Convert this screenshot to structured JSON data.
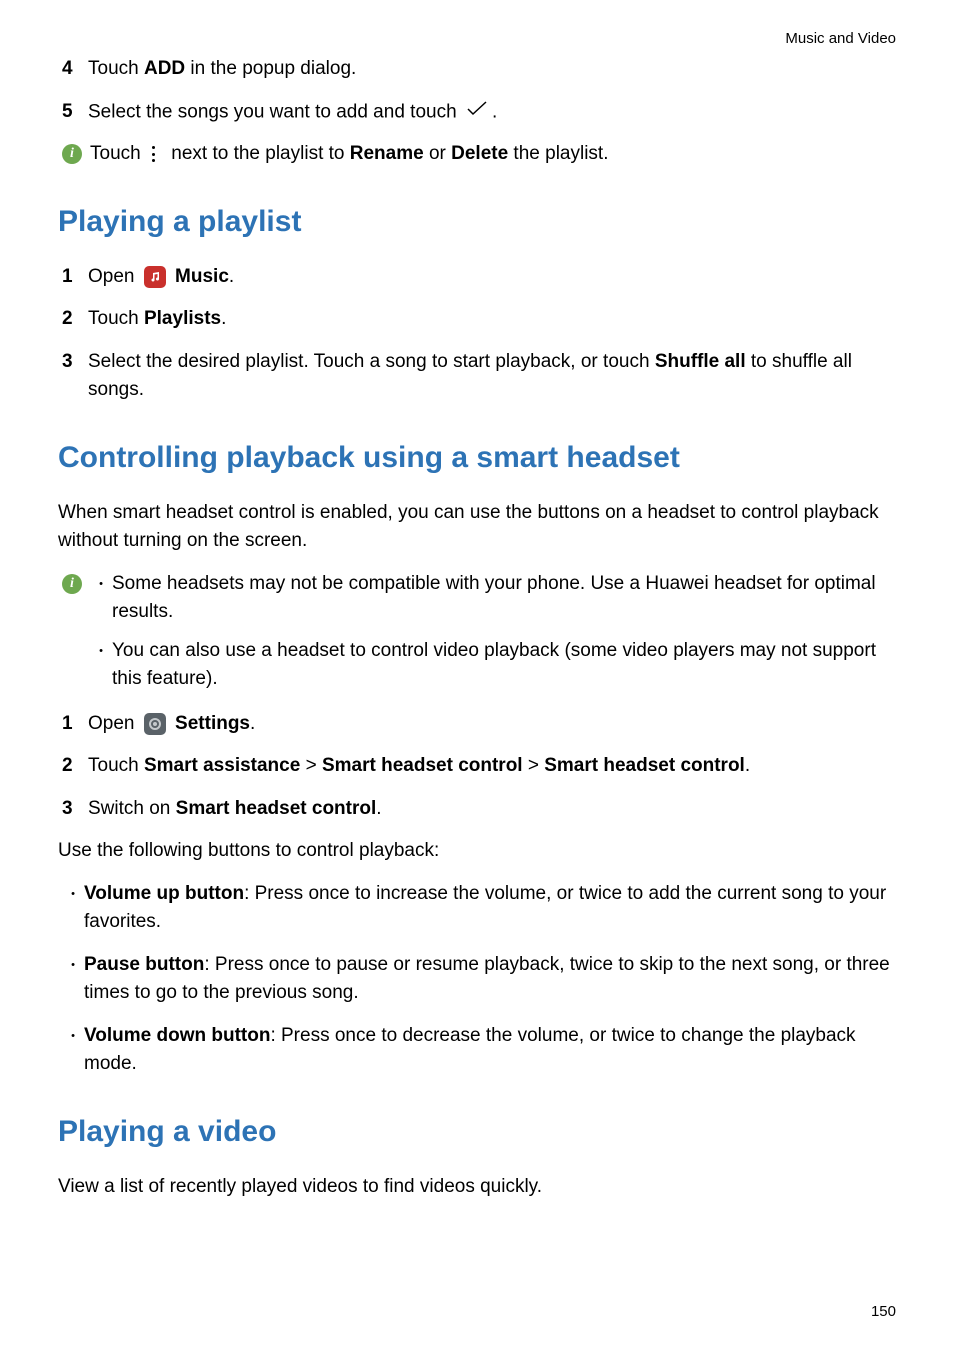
{
  "header": "Music and Video",
  "step4": {
    "num": "4",
    "pre": "Touch ",
    "bold": "ADD",
    "post": " in the popup dialog."
  },
  "step5": {
    "num": "5",
    "pre": "Select the songs you want to add and touch ",
    "post": "."
  },
  "tip1": {
    "pre": "Touch ",
    "mid": " next to the playlist to ",
    "b1": "Rename",
    "or": " or ",
    "b2": "Delete",
    "post": " the playlist."
  },
  "heading1": "Playing a playlist",
  "p1": {
    "num": "1",
    "pre": "Open ",
    "bold": "Music",
    "post": "."
  },
  "p2": {
    "num": "2",
    "pre": "Touch ",
    "bold": "Playlists",
    "post": "."
  },
  "p3": {
    "num": "3",
    "pre": "Select the desired playlist. Touch a song to start playback, or touch ",
    "bold": "Shuffle all",
    "post": " to shuffle all songs."
  },
  "heading2": "Controlling playback using a smart headset",
  "intro2": "When smart headset control is enabled, you can use the buttons on a headset to control playback without turning on the screen.",
  "tipB1": "Some headsets may not be compatible with your phone. Use a Huawei headset for optimal results.",
  "tipB2": "You can also use a headset to control video playback (some video players may not support this feature).",
  "s1": {
    "num": "1",
    "pre": "Open ",
    "bold": "Settings",
    "post": "."
  },
  "s2": {
    "num": "2",
    "pre": "Touch ",
    "b1": "Smart assistance",
    "gt1": " > ",
    "b2": "Smart headset control",
    "gt2": " > ",
    "b3": "Smart headset control",
    "post": "."
  },
  "s3": {
    "num": "3",
    "pre": "Switch on ",
    "bold": "Smart headset control",
    "post": "."
  },
  "useText": "Use the following buttons to control playback:",
  "vb1": {
    "bold": "Volume up button",
    "text": ": Press once to increase the volume, or twice to add the current song to your favorites."
  },
  "vb2": {
    "bold": "Pause button",
    "text": ": Press once to pause or resume playback, twice to skip to the next song, or three times to go to the previous song."
  },
  "vb3": {
    "bold": "Volume down button",
    "text": ": Press once to decrease the volume, or twice to change the playback mode."
  },
  "heading3": "Playing a video",
  "intro3": "View a list of recently played videos to find videos quickly.",
  "pageNum": "150"
}
